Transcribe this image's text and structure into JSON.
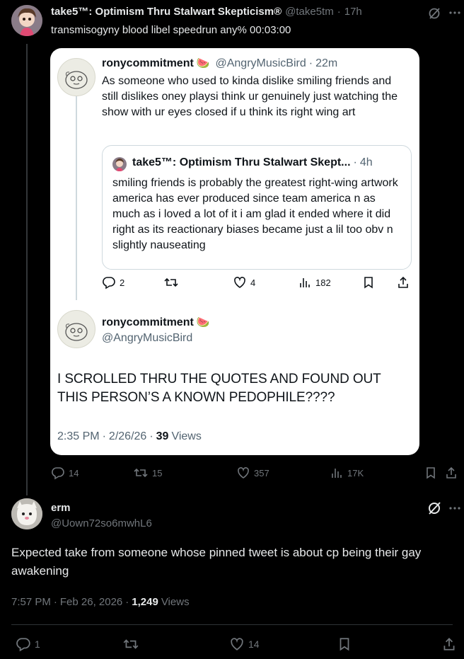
{
  "top_tweet": {
    "display_name": "take5™: Optimism Thru Stalwart Skepticism®",
    "handle": "@take5tm",
    "time": "17h",
    "text": "transmisogyny blood libel speedrun any% 00:03:00",
    "replies": "14",
    "retweets": "15",
    "likes": "357",
    "views": "17K"
  },
  "embedded": {
    "parent": {
      "display_name": "ronycommitment",
      "emoji": "🍉",
      "handle": "@AngryMusicBird",
      "time": "22m",
      "text": "As someone who used to kinda dislike smiling friends and still dislikes oney playsi think ur genuinely just watching the show with ur eyes closed if u think its right wing art"
    },
    "quote": {
      "display_name": "take5™: Optimism Thru Stalwart Skept...",
      "time": "4h",
      "text": "smiling friends is probably the greatest right-wing artwork america has ever produced since team america n as much as i loved a lot of it i am glad it ended where it did right as its reactionary biases became just a lil too obv n slightly nauseating"
    },
    "parent_metrics": {
      "replies": "2",
      "likes": "4",
      "views": "182"
    },
    "main": {
      "display_name": "ronycommitment",
      "emoji": "🍉",
      "handle": "@AngryMusicBird",
      "text": "I SCROLLED THRU THE QUOTES AND FOUND OUT THIS PERSON’S A KNOWN PEDOPHILE????",
      "time": "2:35 PM",
      "date": "2/26/26",
      "views_count": "39",
      "views_label": "Views"
    }
  },
  "reply_tweet": {
    "display_name": "erm",
    "handle": "@Uown72so6mwhL6",
    "text": "Expected take from someone whose pinned tweet is about cp being their gay awakening",
    "time": "7:57 PM",
    "date": "Feb 26, 2026",
    "views_count": "1,249",
    "views_label": "Views",
    "replies": "1",
    "likes": "14"
  },
  "colors": {
    "background": "#000000",
    "text": "#e7e9ea",
    "muted": "#71767b",
    "card": "#ffffff"
  }
}
